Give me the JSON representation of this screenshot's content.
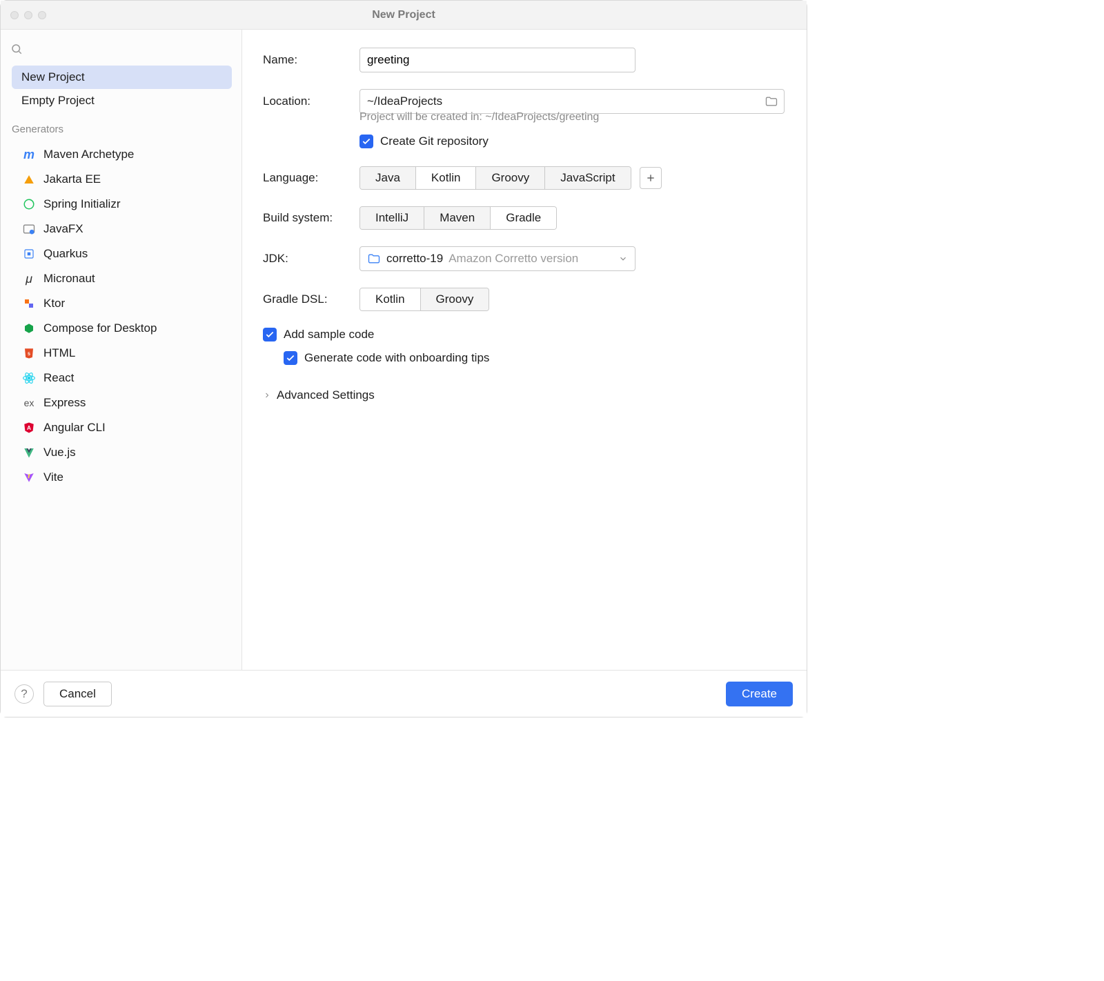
{
  "window": {
    "title": "New Project"
  },
  "sidebar": {
    "projects": [
      {
        "label": "New Project"
      },
      {
        "label": "Empty Project"
      }
    ],
    "generators_caption": "Generators",
    "generators": [
      {
        "label": "Maven Archetype",
        "icon": "mvn"
      },
      {
        "label": "Jakarta EE",
        "icon": "jakarta"
      },
      {
        "label": "Spring Initializr",
        "icon": "spring"
      },
      {
        "label": "JavaFX",
        "icon": "javafx"
      },
      {
        "label": "Quarkus",
        "icon": "quarkus"
      },
      {
        "label": "Micronaut",
        "icon": "micronaut"
      },
      {
        "label": "Ktor",
        "icon": "ktor"
      },
      {
        "label": "Compose for Desktop",
        "icon": "compose"
      },
      {
        "label": "HTML",
        "icon": "html"
      },
      {
        "label": "React",
        "icon": "react"
      },
      {
        "label": "Express",
        "icon": "express"
      },
      {
        "label": "Angular CLI",
        "icon": "angular"
      },
      {
        "label": "Vue.js",
        "icon": "vue"
      },
      {
        "label": "Vite",
        "icon": "vite"
      }
    ]
  },
  "form": {
    "name_label": "Name:",
    "name_value": "greeting",
    "location_label": "Location:",
    "location_value": "~/IdeaProjects",
    "location_hint": "Project will be created in: ~/IdeaProjects/greeting",
    "git_label": "Create Git repository",
    "language_label": "Language:",
    "language_options": [
      "Java",
      "Kotlin",
      "Groovy",
      "JavaScript"
    ],
    "language_selected": "Kotlin",
    "build_label": "Build system:",
    "build_options": [
      "IntelliJ",
      "Maven",
      "Gradle"
    ],
    "build_selected": "Gradle",
    "jdk_label": "JDK:",
    "jdk_name": "corretto-19",
    "jdk_sub": "Amazon Corretto version",
    "dsl_label": "Gradle DSL:",
    "dsl_options": [
      "Kotlin",
      "Groovy"
    ],
    "dsl_selected": "Kotlin",
    "sample_label": "Add sample code",
    "onboard_label": "Generate code with onboarding tips",
    "advanced_label": "Advanced Settings"
  },
  "footer": {
    "cancel": "Cancel",
    "create": "Create"
  }
}
